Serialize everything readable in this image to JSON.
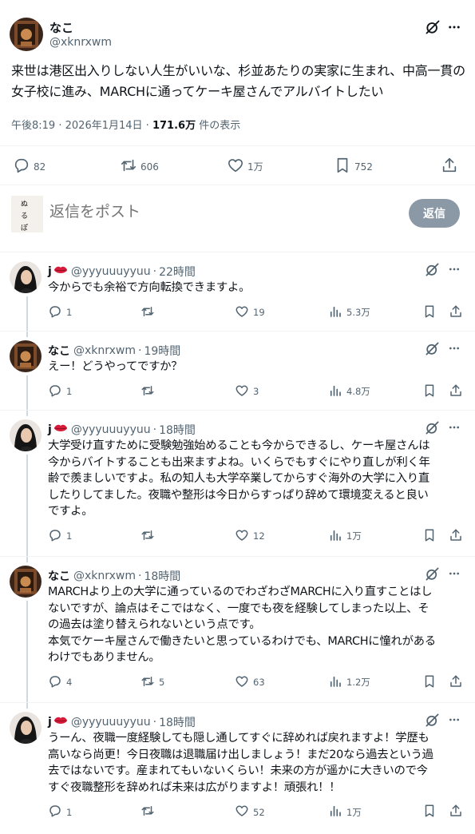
{
  "main_post": {
    "author_name": "なこ",
    "author_handle": "@xknrxwm",
    "text": "来世は港区出入りしない人生がいいな、杉並あたりの実家に生まれ、中高一貫の女子校に進み、MARCHに通ってケーキ屋さんでアルバイトしたい",
    "time": "午後8:19",
    "separator": "·",
    "date": "2026年1月14日",
    "views": "171.6万",
    "views_suffix": "件の表示",
    "stats": {
      "replies": "82",
      "reposts": "606",
      "likes": "1万",
      "bookmarks": "752"
    }
  },
  "compose": {
    "placeholder": "返信をポスト",
    "reply_button": "返信"
  },
  "replies": [
    {
      "name": "j",
      "handle": "@yyyuuuyyuu",
      "time": "22時間",
      "lines": [
        "今からでも余裕で方向転換できますよ。"
      ],
      "stats": {
        "replies": "1",
        "reposts": "",
        "likes": "19",
        "views": "5.3万"
      }
    },
    {
      "name": "なこ",
      "handle": "@xknrxwm",
      "time": "19時間",
      "lines": [
        "えー！どうやってですか？"
      ],
      "stats": {
        "replies": "1",
        "reposts": "",
        "likes": "3",
        "views": "4.8万"
      }
    },
    {
      "name": "j",
      "handle": "@yyyuuuyyuu",
      "time": "18時間",
      "lines": [
        "大学受け直すために受験勉強始めることも今からできるし、ケーキ屋さんは",
        "今からバイトすることも出来ますよね。いくらでもすぐにやり直しが利く年",
        "齢で羨ましいですよ。私の知人も大学卒業してからすぐ海外の大学に入り直",
        "したりしてました。夜職や整形は今日からすっぱり辞めて環境変えると良い",
        "ですよ。"
      ],
      "stats": {
        "replies": "1",
        "reposts": "",
        "likes": "12",
        "views": "1万"
      }
    },
    {
      "name": "なこ",
      "handle": "@xknrxwm",
      "time": "18時間",
      "lines": [
        "MARCHより上の大学に通っているのでわざわざMARCHに入り直すことはし",
        "ないですが、論点はそこではなく、一度でも夜を経験してしまった以上、そ",
        "の過去は塗り替えられないという点です。",
        "本気でケーキ屋さんで働きたいと思っているわけでも、MARCHに憧れがある",
        "わけでもありません。"
      ],
      "stats": {
        "replies": "4",
        "reposts": "5",
        "likes": "63",
        "views": "1.2万"
      }
    },
    {
      "name": "j",
      "handle": "@yyyuuuyyuu",
      "time": "18時間",
      "lines": [
        "うーん、夜職一度経験しても隠し通してすぐに辞めれば戻れますよ！学歴も",
        "高いなら尚更！今日夜職は退職届け出しましょう！まだ20なら過去という過",
        "去ではないです。産まれてもいないくらい！未来の方が遥かに大きいので今",
        "すぐ夜職整形を辞めれば未来は広がりますよ！頑張れ！！"
      ],
      "stats": {
        "replies": "1",
        "reposts": "",
        "likes": "52",
        "views": "1万"
      }
    }
  ],
  "icons": {
    "reply": "reply-icon",
    "repost": "repost-icon",
    "like": "heart-icon",
    "bookmark": "bookmark-icon",
    "share": "share-icon",
    "views": "views-chart-icon",
    "grok": "grok-icon",
    "more": "more-icon",
    "emoji": "lips-emoji"
  },
  "colors": {
    "text": "#0f1419",
    "secondary": "#536471",
    "divider": "#eff3f4",
    "reply_button": "#8b98a5",
    "thread_line": "#cfd9de",
    "lips": "#d81b3a"
  }
}
